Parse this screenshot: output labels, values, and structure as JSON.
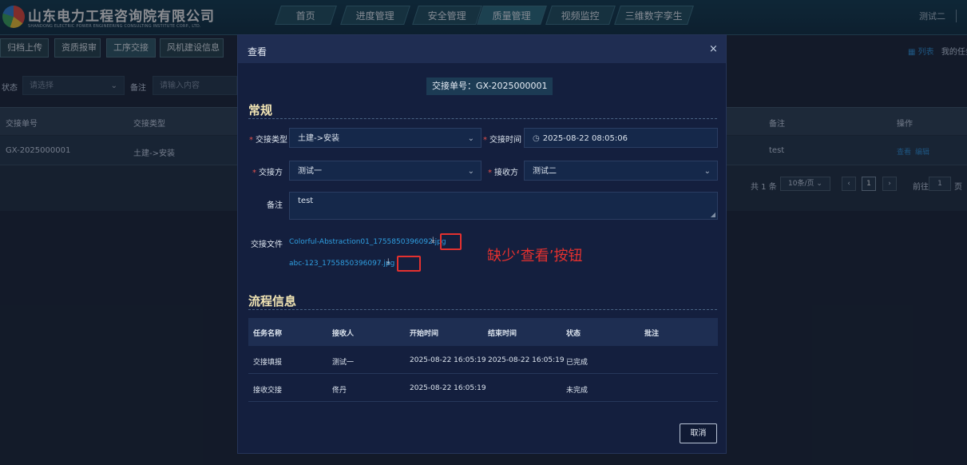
{
  "header": {
    "logo_cn": "山东电力工程咨询院有限公司",
    "logo_en": "SHANDONG ELECTRIC POWER ENGINEERING CONSULTING INSTITUTE CORP., LTD.",
    "nav": [
      "首页",
      "进度管理",
      "安全管理",
      "质量管理",
      "视频监控",
      "三维数字孪生"
    ],
    "active_nav": "质量管理",
    "user": "测试二"
  },
  "subtabs": [
    "归档上传",
    "资质报审",
    "工序交接",
    "风机建设信息"
  ],
  "active_subtab": "工序交接",
  "view_toggle": {
    "list": "列表",
    "mine": "我的任务"
  },
  "filters": {
    "status_label": "状态",
    "status_placeholder": "请选择",
    "remark_label": "备注",
    "remark_placeholder": "请输入内容"
  },
  "background_table": {
    "headers": [
      "交接单号",
      "交接类型",
      "备注",
      "操作"
    ],
    "row": {
      "order_no": "GX-2025000001",
      "type": "土建->安装",
      "remark": "test",
      "view": "查看",
      "edit": "编辑"
    },
    "pager": {
      "total": "共 1 条",
      "page_size": "10条/页",
      "current": "1",
      "goto": "前往",
      "goto_value": "1",
      "page_unit": "页"
    }
  },
  "modal": {
    "title": "查看",
    "order_tag": "交接单号：GX-2025000001",
    "section_general": "常规",
    "fields": {
      "type_label": "交接类型",
      "type_value": "土建->安装",
      "time_label": "交接时间",
      "time_value": "2025-08-22 08:05:06",
      "from_label": "交接方",
      "from_value": "测试一",
      "to_label": "接收方",
      "to_value": "测试二",
      "remark_label": "备注",
      "remark_value": "test",
      "files_label": "交接文件"
    },
    "files": [
      "Colorful-Abstraction01_1755850396092.jpg",
      "abc-123_1755850396097.jpg"
    ],
    "annotation": "缺少‘查看’按钮",
    "section_flow": "流程信息",
    "flow_headers": [
      "任务名称",
      "接收人",
      "开始时间",
      "结束时间",
      "状态",
      "批注"
    ],
    "flow_rows": [
      [
        "交接填报",
        "测试一",
        "2025-08-22 16:05:19",
        "2025-08-22 16:05:19",
        "已完成",
        ""
      ],
      [
        "接收交接",
        "佟丹",
        "2025-08-22 16:05:19",
        "",
        "未完成",
        ""
      ]
    ],
    "cancel": "取消"
  },
  "colors": {
    "accent_link": "#2f8fd4",
    "required": "#e2524d",
    "annotation_red": "#e4312f",
    "section_title": "#f1e4b3"
  }
}
